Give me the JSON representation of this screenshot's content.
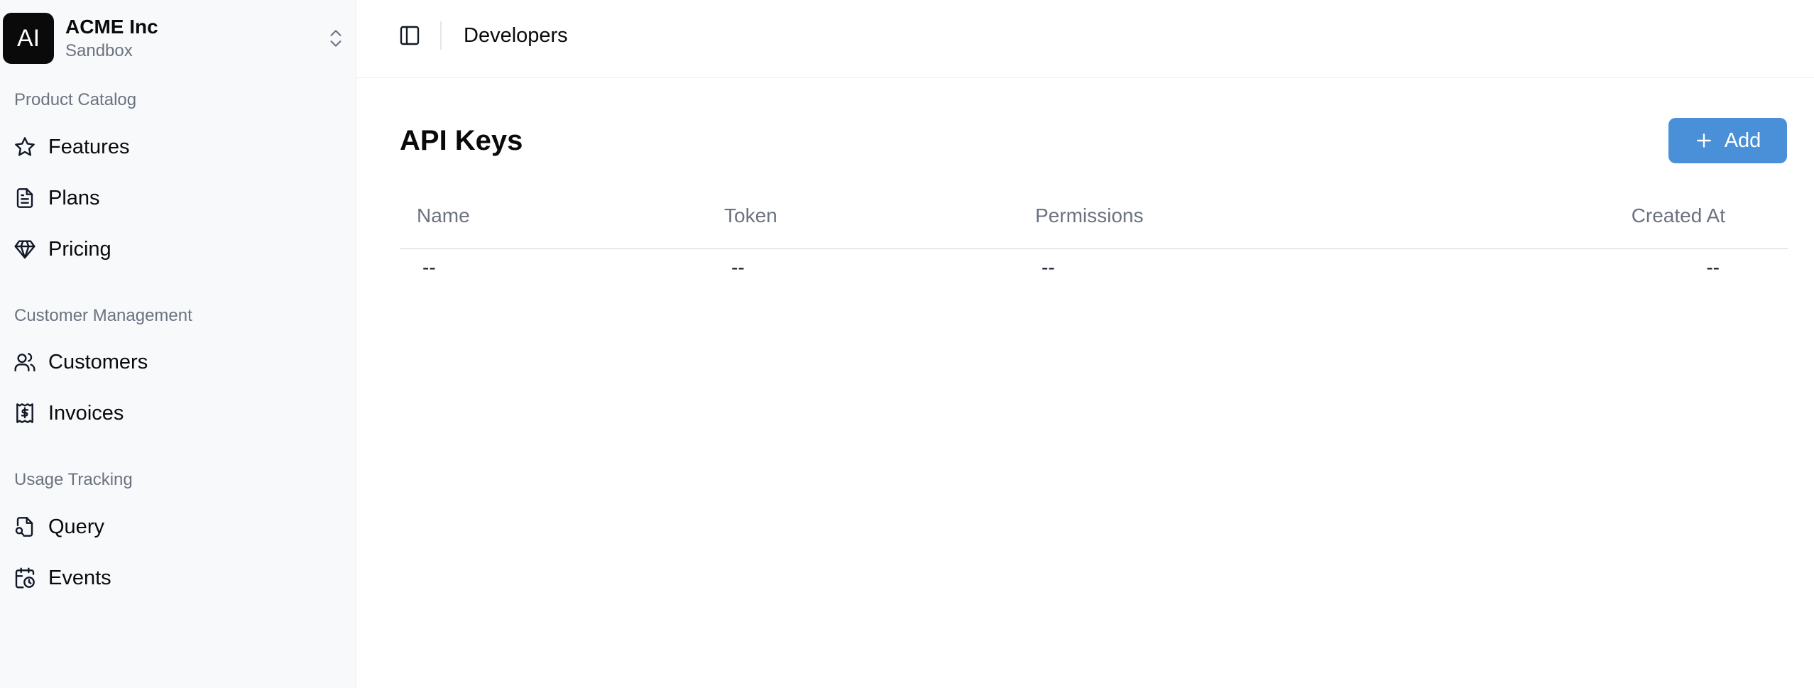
{
  "org": {
    "logo_text": "AI",
    "name": "ACME Inc",
    "environment": "Sandbox"
  },
  "sidebar": {
    "sections": [
      {
        "label": "Product Catalog",
        "items": [
          {
            "label": "Features",
            "icon": "star-icon"
          },
          {
            "label": "Plans",
            "icon": "document-icon"
          },
          {
            "label": "Pricing",
            "icon": "gem-icon"
          }
        ]
      },
      {
        "label": "Customer Management",
        "items": [
          {
            "label": "Customers",
            "icon": "users-icon"
          },
          {
            "label": "Invoices",
            "icon": "receipt-dollar-icon"
          }
        ]
      },
      {
        "label": "Usage Tracking",
        "items": [
          {
            "label": "Query",
            "icon": "file-search-icon"
          },
          {
            "label": "Events",
            "icon": "calendar-clock-icon"
          }
        ]
      }
    ]
  },
  "header": {
    "title": "Developers"
  },
  "main": {
    "page_title": "API Keys",
    "add_button_label": "Add",
    "table": {
      "columns": [
        "Name",
        "Token",
        "Permissions",
        "Created At"
      ],
      "rows": [
        [
          "--",
          "--",
          "--",
          "--"
        ]
      ]
    }
  },
  "colors": {
    "accent": "#4a90d9",
    "sidebar_bg": "#f8f9fb",
    "muted_text": "#6b7280"
  }
}
